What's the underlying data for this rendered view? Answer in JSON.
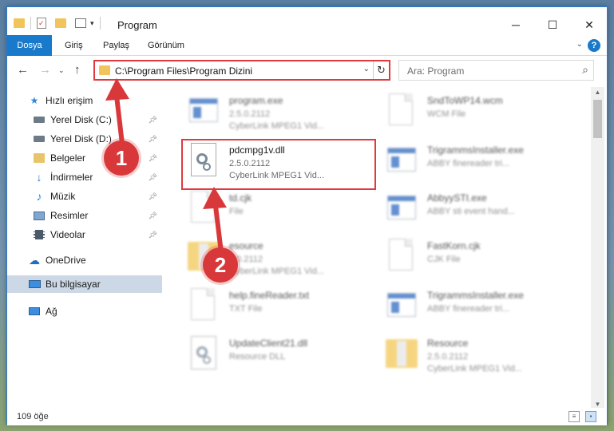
{
  "window": {
    "title": "Program"
  },
  "ribbon": {
    "tabs": [
      "Dosya",
      "Giriş",
      "Paylaş",
      "Görünüm"
    ],
    "help": "?"
  },
  "nav": {
    "address": "C:\\Program Files\\Program Dizini",
    "search_placeholder": "Ara: Program"
  },
  "sidebar": {
    "items": [
      {
        "label": "Hızlı erişim",
        "icon": "star-icon"
      },
      {
        "label": "Yerel Disk (C:)",
        "icon": "drive-icon"
      },
      {
        "label": "Yerel Disk (D:)",
        "icon": "drive-icon"
      },
      {
        "label": "Belgeler",
        "icon": "documents-icon"
      },
      {
        "label": "İndirmeler",
        "icon": "downloads-icon"
      },
      {
        "label": "Müzik",
        "icon": "music-icon"
      },
      {
        "label": "Resimler",
        "icon": "pictures-icon"
      },
      {
        "label": "Videolar",
        "icon": "videos-icon"
      },
      {
        "label": "OneDrive",
        "icon": "cloud-icon"
      },
      {
        "label": "Bu bilgisayar",
        "icon": "computer-icon"
      },
      {
        "label": "Ağ",
        "icon": "network-icon"
      }
    ]
  },
  "files": [
    {
      "name": "program.exe",
      "line1": "2.5.0.2112",
      "line2": "CyberLink MPEG1 Vid...",
      "icon": "exe-icon"
    },
    {
      "name": "SndToWP14.wcm",
      "line1": "WCM File",
      "line2": "",
      "icon": "document-icon"
    },
    {
      "name": "pdcmpg1v.dll",
      "line1": "2.5.0.2112",
      "line2": "CyberLink MPEG1 Vid...",
      "icon": "dll-icon"
    },
    {
      "name": "TrigrammsInstaller.exe",
      "line1": "ABBY finereader tri...",
      "line2": "",
      "icon": "exe-icon"
    },
    {
      "name": "td.cjk",
      "line1": "File",
      "line2": "",
      "icon": "document-icon"
    },
    {
      "name": "AbbyySTI.exe",
      "line1": "ABBY sti event hand...",
      "line2": "",
      "icon": "exe-icon"
    },
    {
      "name": "esource",
      "line1": "5.0.2112",
      "line2": "CyberLink MPEG1 Vid...",
      "icon": "folder-icon"
    },
    {
      "name": "FastKorn.cjk",
      "line1": "CJK File",
      "line2": "",
      "icon": "document-icon"
    },
    {
      "name": "help.fineReader.txt",
      "line1": "TXT File",
      "line2": "",
      "icon": "document-icon"
    },
    {
      "name": "TrigrammsInstaller.exe",
      "line1": "ABBY finereader tri...",
      "line2": "",
      "icon": "exe-icon"
    },
    {
      "name": "UpdateClient21.dll",
      "line1": "Resource DLL",
      "line2": "",
      "icon": "dll-icon"
    },
    {
      "name": "Resource",
      "line1": "2.5.0.2112",
      "line2": "CyberLink MPEG1 Vid...",
      "icon": "folder-icon"
    }
  ],
  "status": {
    "count": "109 öğe"
  },
  "callouts": [
    "1",
    "2"
  ],
  "colors": {
    "accent": "#1979ca",
    "highlight": "#e0393e",
    "callout": "#d8383a"
  }
}
